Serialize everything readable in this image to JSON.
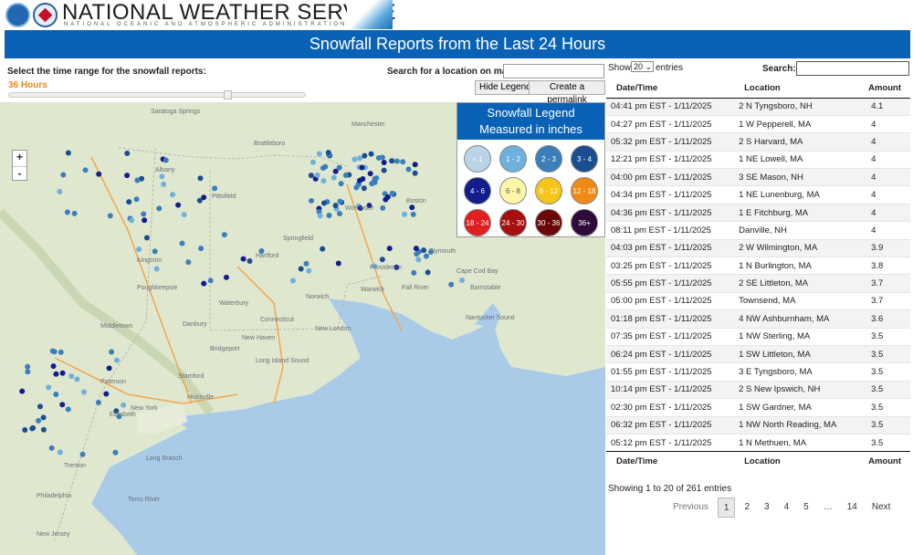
{
  "header": {
    "title": "NATIONAL WEATHER SERVICE",
    "subtitle": "NATIONAL OCEANIC AND ATMOSPHERIC ADMINISTRATION"
  },
  "banner": {
    "title": "Snowfall Reports from the Last 24 Hours"
  },
  "controls": {
    "range_label": "Select the time range for the snowfall reports:",
    "range_value": "36 Hours",
    "search_label": "Search for a location on map:",
    "search_value": "",
    "hide_legend": "Hide Legend",
    "permalink": "Create a permalink",
    "zoom_in": "+",
    "zoom_out": "-"
  },
  "legend": {
    "title": "Snowfall Legend",
    "subtitle": "Measured in inches",
    "items": [
      {
        "label": "< 1",
        "color": "#b9d4e6"
      },
      {
        "label": "1 - 2",
        "color": "#6fb0dc"
      },
      {
        "label": "2 - 3",
        "color": "#3b7fba"
      },
      {
        "label": "3 - 4",
        "color": "#1b4d91"
      },
      {
        "label": "4 - 6",
        "color": "#111e8e"
      },
      {
        "label": "6 - 8",
        "color": "#fff5a6"
      },
      {
        "label": "8 - 12",
        "color": "#f5c518"
      },
      {
        "label": "12 - 18",
        "color": "#f08a17"
      },
      {
        "label": "18 - 24",
        "color": "#e02020"
      },
      {
        "label": "24 - 30",
        "color": "#a50f0f"
      },
      {
        "label": "30 - 36",
        "color": "#6b0707"
      },
      {
        "label": "36+",
        "color": "#2e0a3a"
      }
    ]
  },
  "map_labels": [
    "Saratoga Springs",
    "Albany",
    "Kingston",
    "Poughkeepsie",
    "Middletown",
    "Danbury",
    "Waterbury",
    "Hartford",
    "Springfield",
    "Pittsfield",
    "Brattleboro",
    "Manchester",
    "Worcester",
    "Providence",
    "New Haven",
    "Bridgeport",
    "Stamford",
    "Connecticut",
    "Long Island Sound",
    "New York",
    "Trenton",
    "Philadelphia",
    "Toms River",
    "Cape Cod Bay",
    "Barnstable",
    "Nantucket Sound",
    "Boston",
    "Plymouth",
    "New London",
    "Paterson",
    "Elizabeth",
    "Long Branch",
    "New Jersey",
    "Fall River",
    "Norwich",
    "Warwick",
    "Hicksville"
  ],
  "table": {
    "show": "Show",
    "page_size": "20",
    "entries": "entries",
    "search_label": "Search:",
    "search_value": "",
    "columns": [
      "Date/Time",
      "Location",
      "Amount"
    ],
    "rows": [
      [
        "04:41 pm EST - 1/11/2025",
        "2 N Tyngsboro, NH",
        "4.1"
      ],
      [
        "04:27 pm EST - 1/11/2025",
        "1 W Pepperell, MA",
        "4"
      ],
      [
        "05:32 pm EST - 1/11/2025",
        "2 S Harvard, MA",
        "4"
      ],
      [
        "12:21 pm EST - 1/11/2025",
        "1 NE Lowell, MA",
        "4"
      ],
      [
        "04:00 pm EST - 1/11/2025",
        "3 SE Mason, NH",
        "4"
      ],
      [
        "04:34 pm EST - 1/11/2025",
        "1 NE Lunenburg, MA",
        "4"
      ],
      [
        "04:36 pm EST - 1/11/2025",
        "1 E Fitchburg, MA",
        "4"
      ],
      [
        "08:11 pm EST - 1/11/2025",
        "Danville, NH",
        "4"
      ],
      [
        "04:03 pm EST - 1/11/2025",
        "2 W Wilmington, MA",
        "3.9"
      ],
      [
        "03:25 pm EST - 1/11/2025",
        "1 N Burlington, MA",
        "3.8"
      ],
      [
        "05:55 pm EST - 1/11/2025",
        "2 SE Littleton, MA",
        "3.7"
      ],
      [
        "05:00 pm EST - 1/11/2025",
        "Townsend, MA",
        "3.7"
      ],
      [
        "01:18 pm EST - 1/11/2025",
        "4 NW Ashburnham, MA",
        "3.6"
      ],
      [
        "07:35 pm EST - 1/11/2025",
        "1 NW Sterling, MA",
        "3.5"
      ],
      [
        "06:24 pm EST - 1/11/2025",
        "1 SW Littleton, MA",
        "3.5"
      ],
      [
        "01:55 pm EST - 1/11/2025",
        "3 E Tyngsboro, MA",
        "3.5"
      ],
      [
        "10:14 pm EST - 1/11/2025",
        "2 S New Ipswich, NH",
        "3.5"
      ],
      [
        "02:30 pm EST - 1/11/2025",
        "1 SW Gardner, MA",
        "3.5"
      ],
      [
        "06:32 pm EST - 1/11/2025",
        "1 NW North Reading, MA",
        "3.5"
      ],
      [
        "05:12 pm EST - 1/11/2025",
        "1 N Methuen, MA",
        "3.5"
      ]
    ],
    "info": "Showing 1 to 20 of 261 entries",
    "pagination": [
      "Previous",
      "1",
      "2",
      "3",
      "4",
      "5",
      "…",
      "14",
      "Next"
    ]
  }
}
